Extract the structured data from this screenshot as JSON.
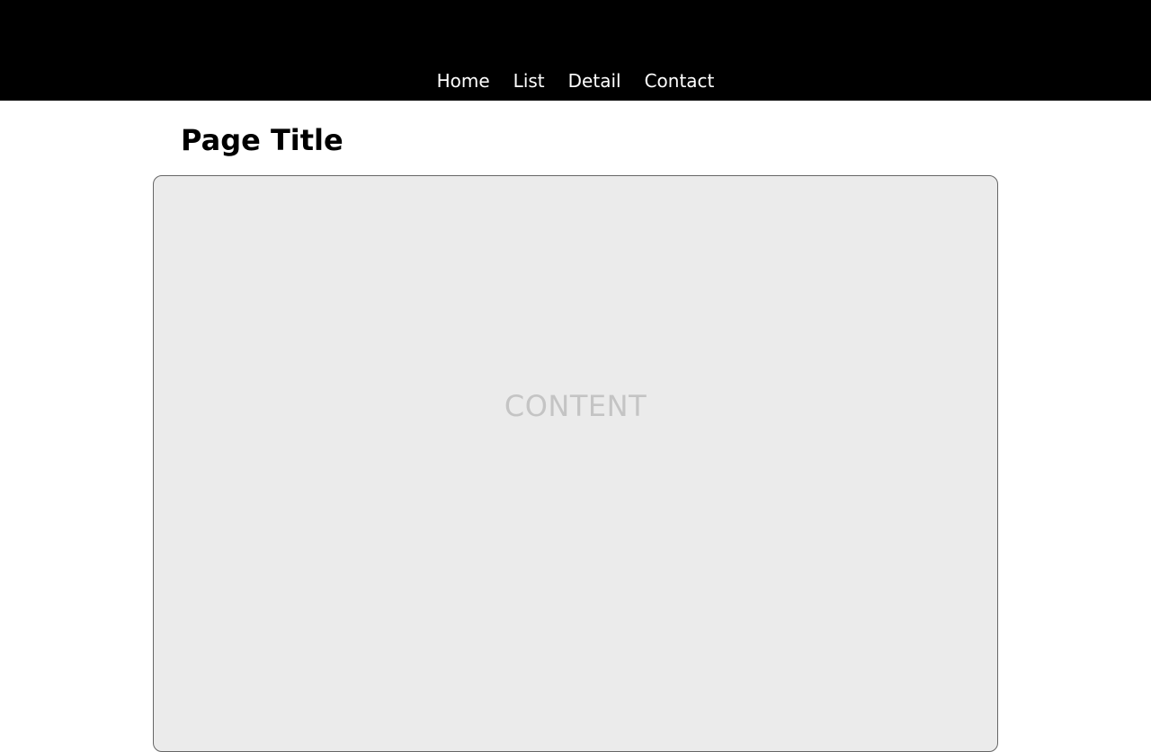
{
  "header": {
    "nav": [
      {
        "label": "Home"
      },
      {
        "label": "List"
      },
      {
        "label": "Detail"
      },
      {
        "label": "Contact"
      }
    ]
  },
  "main": {
    "title": "Page Title",
    "content_placeholder": "CONTENT"
  },
  "colors": {
    "header_background": "#000000",
    "nav_text": "#ffffff",
    "panel_background": "#ebebeb",
    "panel_border": "#666666",
    "placeholder_text": "#c4c4c4"
  }
}
